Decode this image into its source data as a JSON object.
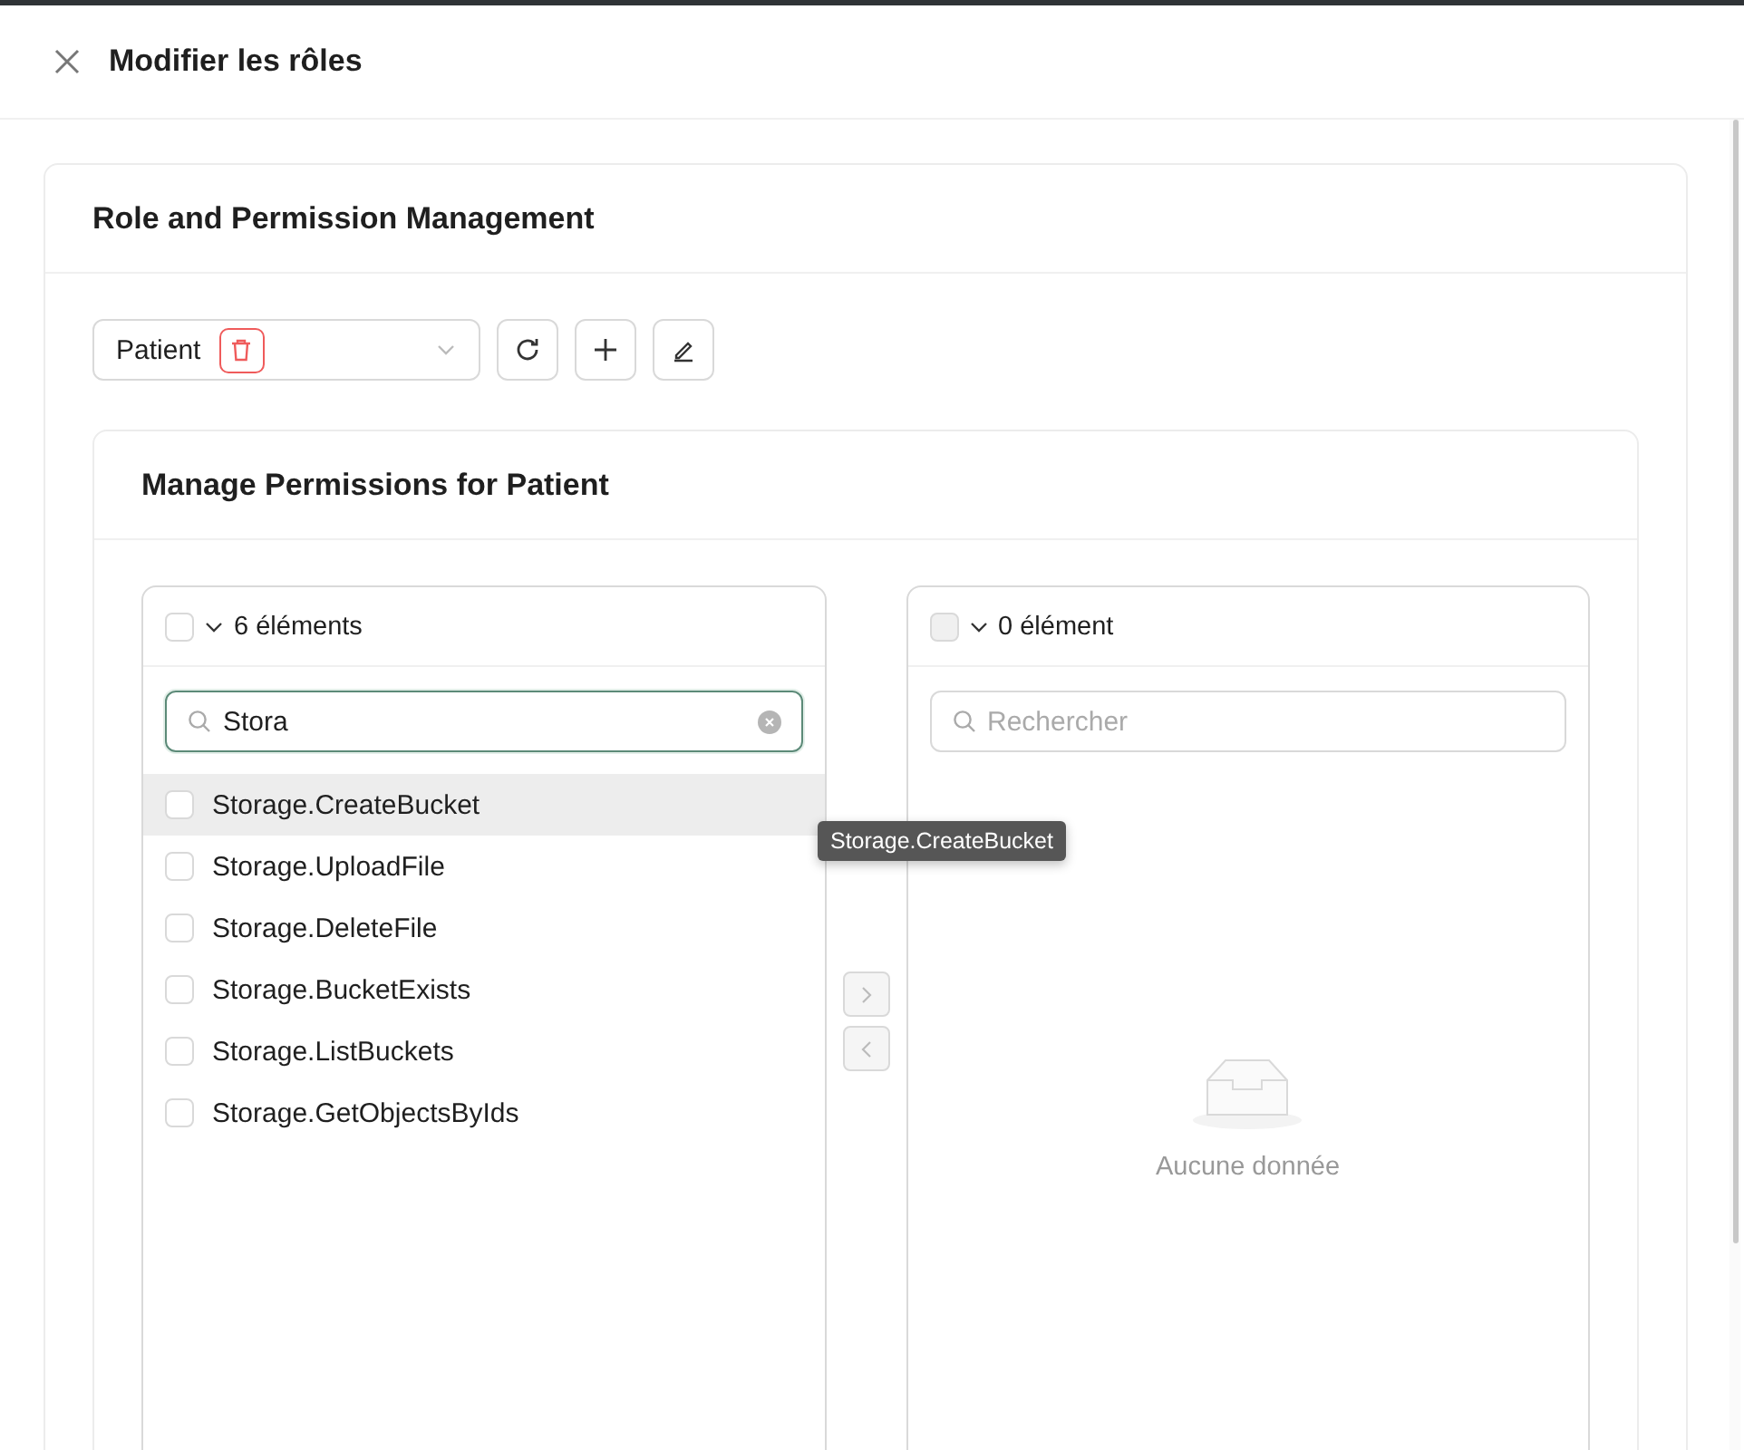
{
  "drawer": {
    "title": "Modifier les rôles"
  },
  "card": {
    "title": "Role and Permission Management"
  },
  "role_select": {
    "value": "Patient"
  },
  "toolbar_buttons": [
    {
      "kind": "refresh"
    },
    {
      "kind": "add"
    },
    {
      "kind": "edit"
    }
  ],
  "permissions": {
    "title": "Manage Permissions for Patient",
    "source": {
      "checked": false,
      "disabled": false,
      "count": "6 éléments",
      "search": {
        "value": "Stora",
        "focused": true
      },
      "items": [
        {
          "label": "Storage.CreateBucket",
          "checked": false,
          "highlighted": true
        },
        {
          "label": "Storage.UploadFile",
          "checked": false,
          "highlighted": false
        },
        {
          "label": "Storage.DeleteFile",
          "checked": false,
          "highlighted": false
        },
        {
          "label": "Storage.BucketExists",
          "checked": false,
          "highlighted": false
        },
        {
          "label": "Storage.ListBuckets",
          "checked": false,
          "highlighted": false
        },
        {
          "label": "Storage.GetObjectsByIds",
          "checked": false,
          "highlighted": false
        }
      ]
    },
    "move_buttons": [
      {
        "kind": "right",
        "disabled": true
      },
      {
        "kind": "left",
        "disabled": true
      }
    ],
    "target": {
      "checked": false,
      "disabled": true,
      "count": "0 élément",
      "search": {
        "placeholder": "Rechercher",
        "focused": false
      },
      "empty": "Aucune donnée"
    },
    "tooltip": "Storage.CreateBucket"
  }
}
